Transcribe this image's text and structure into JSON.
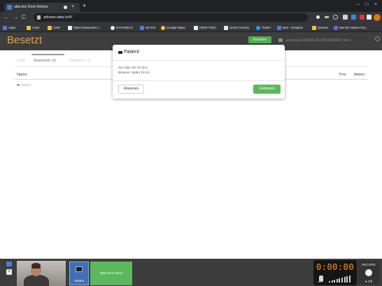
{
  "browser": {
    "tab_title": "aiba.live Desk Adviser",
    "tab_close": "×",
    "new_tab": "+",
    "window_controls": [
      "–",
      "□",
      "×"
    ],
    "back": "←",
    "forward": "→",
    "reload": "C",
    "url": "adviser.adia.tv/#/",
    "bookmarks": [
      {
        "label": "Apps",
        "color": "#4a7fd0"
      },
      {
        "label": "Links",
        "color": "#f2c037"
      },
      {
        "label": "CMS",
        "color": "#f2c037"
      },
      {
        "label": "https://www.wien-i...",
        "color": "#e8eaed"
      },
      {
        "label": "DYNAMICS",
        "color": "#e8eaed"
      },
      {
        "label": "DE-EN",
        "color": "#4a7fd0"
      },
      {
        "label": "Google Maps",
        "color": "#f2c037"
      },
      {
        "label": "MOW Trello",
        "color": "#e8eaed"
      },
      {
        "label": "Smart Factory",
        "color": "#e8eaed"
      },
      {
        "label": "Twitter",
        "color": "#1da1f2"
      },
      {
        "label": "Bert - Dropbox",
        "color": "#4a7fd0"
      },
      {
        "label": "Diverse",
        "color": "#f2c037"
      },
      {
        "label": "Monitor Status Not...",
        "color": "#7b5bd6"
      }
    ]
  },
  "app": {
    "status_title": "Besetzt",
    "status_color": "#e7a13b",
    "green_pill": "Einladen",
    "user_info": "seescout.at (ADIA.DE ONLINE/DE) ▾   de ▾",
    "tabs": [
      "Chat",
      "Warteliste (0)",
      "Sitzleitern (1)"
    ],
    "active_tab": "Warteliste (0)",
    "columns": {
      "name": "Name",
      "pos": "Pos",
      "aktion": "Aktion"
    },
    "rows": [
      {
        "name": "Patient"
      }
    ]
  },
  "modal": {
    "title": "Patient",
    "os": "OS: Mac OS 10.15.3",
    "browser": "Browser: Safari 13.0.5",
    "reject_label": "Abweisen",
    "connect_label": "Verbinden",
    "connect_color": "#5cb85c"
  },
  "bottom": {
    "video_label": "VIDEO",
    "screen_label": "Bildschirm teilen",
    "timer": "0:00:00",
    "record_label": "RECORD",
    "record_state": "● Off",
    "audio_level_bars": [
      2,
      3,
      4,
      5,
      6,
      7,
      8,
      9,
      10
    ]
  }
}
